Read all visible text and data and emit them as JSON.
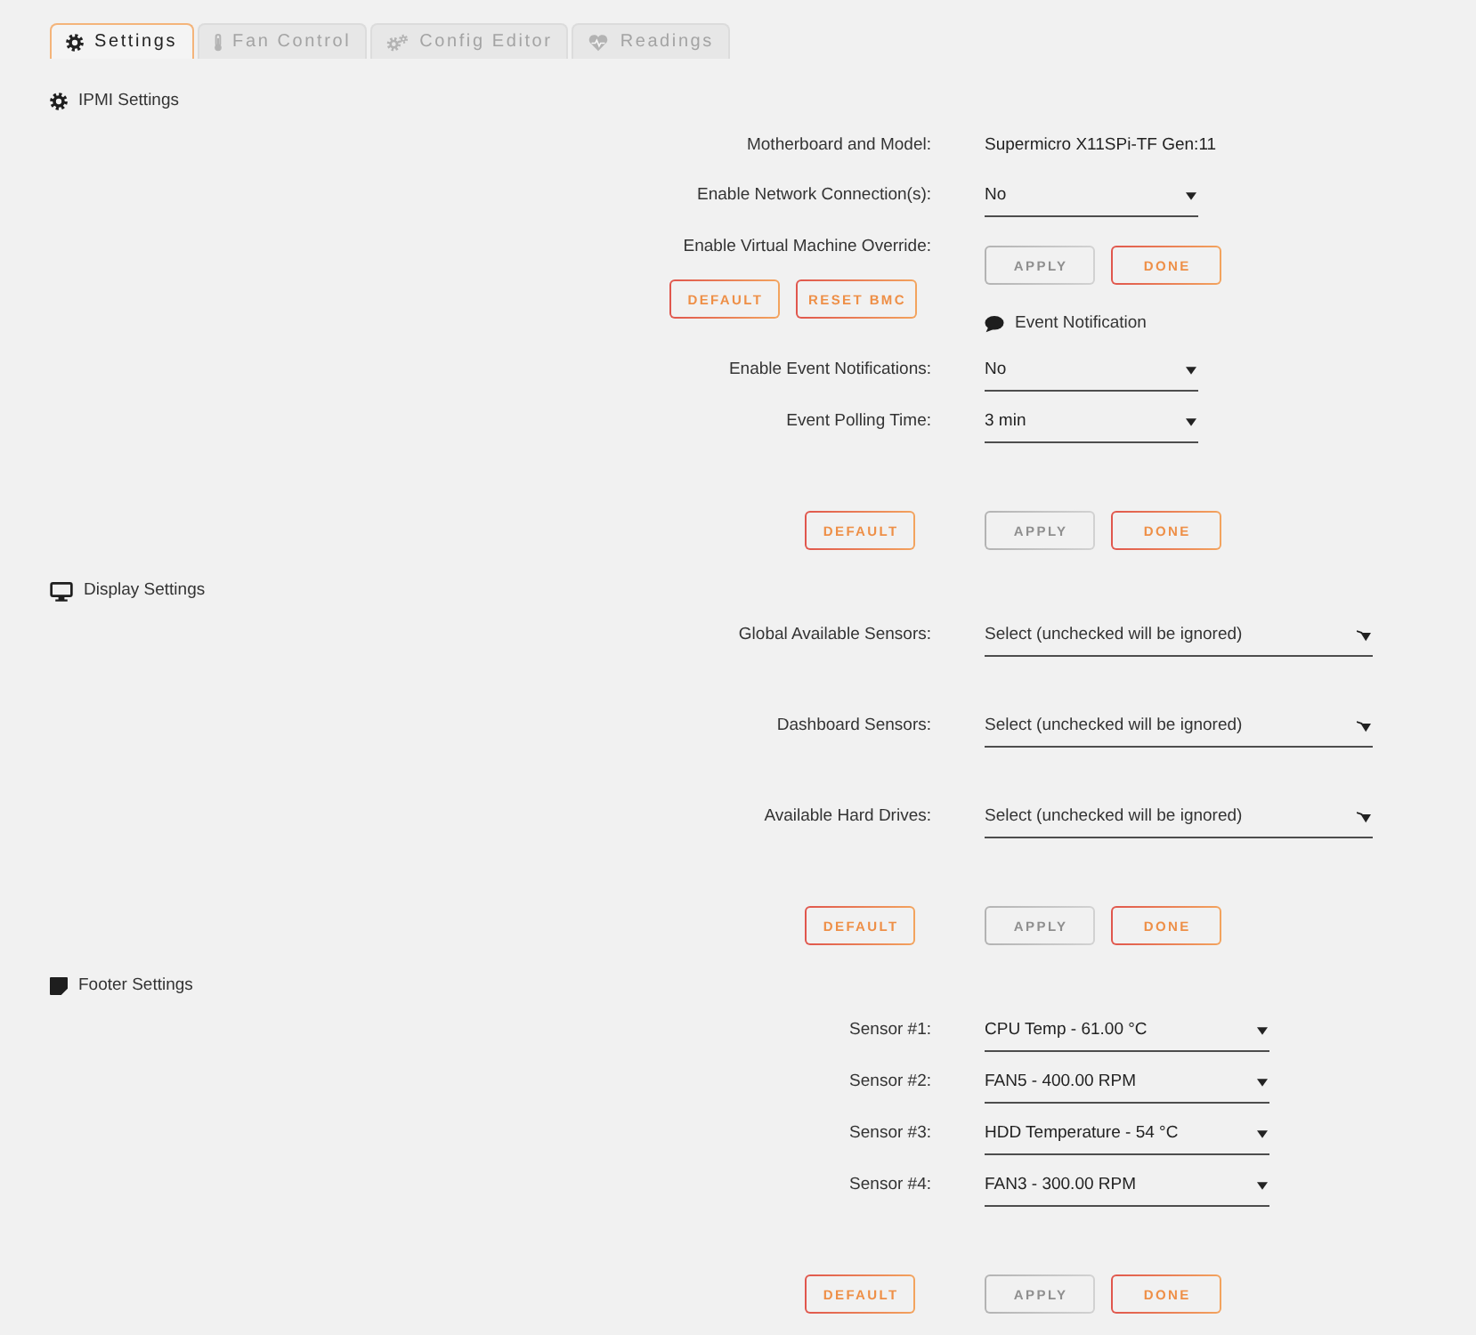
{
  "tabs": [
    {
      "label": "Settings",
      "selected": true
    },
    {
      "label": "Fan Control",
      "selected": false
    },
    {
      "label": "Config Editor",
      "selected": false
    },
    {
      "label": "Readings",
      "selected": false
    }
  ],
  "sections": [
    {
      "title": "IPMI Settings",
      "rows": [
        {
          "kind": "info",
          "label": "Motherboard and Model:",
          "value": "Supermicro X11SPi-TF Gen:11"
        },
        {
          "kind": "select",
          "label": "Enable Network Connection(s):",
          "value": "No"
        },
        {
          "kind": "actions",
          "label": "Enable Virtual Machine Override:",
          "left_buttons": [
            {
              "label": "DEFAULT",
              "disabled": false
            },
            {
              "label": "RESET BMC",
              "disabled": false
            }
          ],
          "right_buttons": [
            {
              "label": "APPLY",
              "disabled": true
            },
            {
              "label": "DONE",
              "disabled": false
            }
          ],
          "subheading": "Event Notification"
        },
        {
          "kind": "select",
          "label": "Enable Event Notifications:",
          "value": "No"
        },
        {
          "kind": "select",
          "label": "Event Polling Time:",
          "value": "3 min"
        }
      ],
      "buttons": {
        "left": [
          {
            "label": "DEFAULT",
            "disabled": false
          }
        ],
        "right": [
          {
            "label": "APPLY",
            "disabled": true
          },
          {
            "label": "DONE",
            "disabled": false
          }
        ]
      }
    },
    {
      "title": "Display Settings",
      "rows": [
        {
          "kind": "multiselect",
          "label": "Global Available Sensors:",
          "placeholder": "Select (unchecked will be ignored)"
        },
        {
          "kind": "multiselect",
          "label": "Dashboard Sensors:",
          "placeholder": "Select (unchecked will be ignored)"
        },
        {
          "kind": "multiselect",
          "label": "Available Hard Drives:",
          "placeholder": "Select (unchecked will be ignored)"
        }
      ],
      "buttons": {
        "left": [
          {
            "label": "DEFAULT",
            "disabled": false
          }
        ],
        "right": [
          {
            "label": "APPLY",
            "disabled": true
          },
          {
            "label": "DONE",
            "disabled": false
          }
        ]
      }
    },
    {
      "title": "Footer Settings",
      "rows": [
        {
          "kind": "select",
          "label": "Sensor #1:",
          "value": "CPU Temp - 61.00 °C"
        },
        {
          "kind": "select",
          "label": "Sensor #2:",
          "value": "FAN5 - 400.00 RPM"
        },
        {
          "kind": "select",
          "label": "Sensor #3:",
          "value": "HDD Temperature - 54 °C"
        },
        {
          "kind": "select",
          "label": "Sensor #4:",
          "value": "FAN3 - 300.00 RPM"
        }
      ],
      "buttons": {
        "left": [
          {
            "label": "DEFAULT",
            "disabled": false
          }
        ],
        "right": [
          {
            "label": "APPLY",
            "disabled": true
          },
          {
            "label": "DONE",
            "disabled": false
          }
        ]
      }
    }
  ]
}
